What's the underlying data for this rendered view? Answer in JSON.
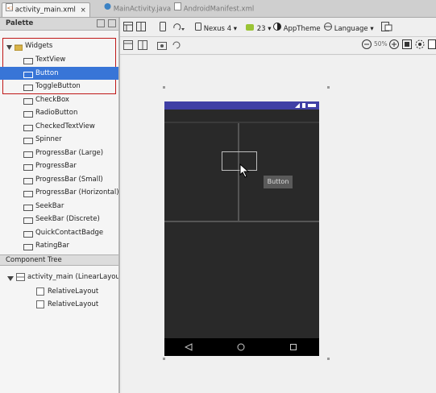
{
  "tabs": [
    {
      "label": "activity_main.xml",
      "close": "×",
      "active": true
    },
    {
      "label": "MainActivity.java",
      "active": false
    },
    {
      "label": "AndroidManifest.xml",
      "active": false
    }
  ],
  "palette": {
    "title": "Palette",
    "widgets_group": "Widgets",
    "items": [
      {
        "label": "TextView"
      },
      {
        "label": "Button"
      },
      {
        "label": "ToggleButton"
      },
      {
        "label": "CheckBox"
      },
      {
        "label": "RadioButton"
      },
      {
        "label": "CheckedTextView"
      },
      {
        "label": "Spinner"
      },
      {
        "label": "ProgressBar (Large)"
      },
      {
        "label": "ProgressBar"
      },
      {
        "label": "ProgressBar (Small)"
      },
      {
        "label": "ProgressBar (Horizontal)"
      },
      {
        "label": "SeekBar"
      },
      {
        "label": "SeekBar (Discrete)"
      },
      {
        "label": "QuickContactBadge"
      },
      {
        "label": "RatingBar"
      }
    ],
    "selected_index": 1
  },
  "component_tree": {
    "title": "Component Tree",
    "root": "activity_main (LinearLayout)",
    "children": [
      "RelativeLayout",
      "RelativeLayout"
    ]
  },
  "toolbar": {
    "device": "Nexus 4",
    "api": "23",
    "theme": "AppTheme",
    "language": "Language",
    "zoom": "50%"
  },
  "tooltip": "Button",
  "colors": {
    "status_bar": "#3f3fa5",
    "device_bg": "#292929",
    "selection": "#3875d7",
    "highlight_box": "#c01818"
  }
}
